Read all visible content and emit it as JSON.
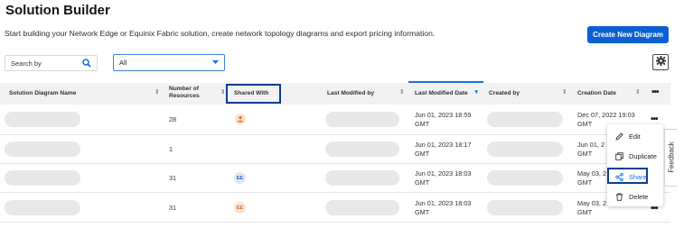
{
  "page": {
    "title": "Solution Builder",
    "subtitle": "Start building your Network Edge or Equinix Fabric solution, create network topology diagrams and export pricing information.",
    "create_button": "Create New Diagram"
  },
  "filters": {
    "search_placeholder": "Search by",
    "select_value": "All"
  },
  "table": {
    "columns": {
      "name": "Solution Diagram Name",
      "resources_line1": "Number of",
      "resources_line2": "Resources",
      "shared": "Shared With",
      "last_modified_by": "Last Modified by",
      "last_modified_date": "Last Modified Date",
      "created_by": "Created by",
      "creation_date": "Creation Date"
    },
    "rows": [
      {
        "resources": "28",
        "shared": "user-icon",
        "modified_date": "Jun 01, 2023 18:59",
        "modified_tz": "GMT",
        "creation_date": "Dec 07, 2022 19:03",
        "creation_tz": "GMT"
      },
      {
        "resources": "1",
        "shared": "",
        "modified_date": "Jun 01, 2023 18:17",
        "modified_tz": "GMT",
        "creation_date": "Jun 01, 2",
        "creation_tz": "GMT"
      },
      {
        "resources": "31",
        "shared": "EE",
        "shared_color": "#dbe9fb",
        "shared_text_color": "#2c5fa8",
        "modified_date": "Jun 01, 2023 18:03",
        "modified_tz": "GMT",
        "creation_date": "May 03, 2",
        "creation_tz": "GMT"
      },
      {
        "resources": "31",
        "shared": "EE",
        "shared_color": "#fde4d3",
        "shared_text_color": "#c2612a",
        "modified_date": "Jun 01, 2023 18:03",
        "modified_tz": "GMT",
        "creation_date": "May 03, 2",
        "creation_tz": "GMT"
      }
    ]
  },
  "context_menu": {
    "items": [
      "Edit",
      "Duplicate",
      "Share",
      "Delete"
    ]
  },
  "feedback": "Feedback",
  "colors": {
    "accent": "#0b5fd1",
    "highlight": "#0a3e8f"
  }
}
